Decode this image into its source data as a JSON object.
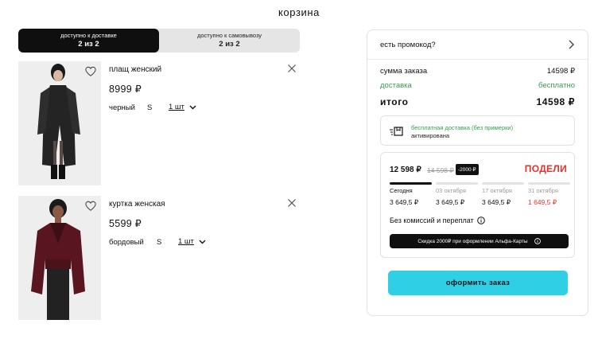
{
  "page": {
    "title": "корзина"
  },
  "delivery_tabs": [
    {
      "label": "доступно к доставке",
      "count": "2 из 2",
      "active": true
    },
    {
      "label": "доступно к самовывозу",
      "count": "2 из 2",
      "active": false
    }
  ],
  "products": [
    {
      "name": "плащ женский",
      "price": "8999 ₽",
      "color": "черный",
      "size": "S",
      "qty": "1 шт",
      "icon_favorite": "heart-icon",
      "icon_remove": "close-icon"
    },
    {
      "name": "куртка женская",
      "price": "5599 ₽",
      "color": "бордовый",
      "size": "S",
      "qty": "1 шт",
      "icon_favorite": "heart-icon",
      "icon_remove": "close-icon"
    }
  ],
  "summary": {
    "promo_label": "есть промокод?",
    "order_sum_label": "сумма заказа",
    "order_sum_value": "14598 ₽",
    "delivery_label": "доставка",
    "delivery_value": "бесплатно",
    "total_label": "итого",
    "total_value": "14598 ₽",
    "free_delivery_line1": "бесплатная доставка (без примерки)",
    "free_delivery_line2": "активирована",
    "checkout_label": "оформить заказ",
    "accent_color": "#2fd0e5",
    "green_color": "#33a04a"
  },
  "split": {
    "brand": "ПОДЕЛИ",
    "price": "12 598 ₽",
    "old_price": "14 598 ₽",
    "discount_badge": "-2000 ₽",
    "payments": [
      {
        "date": "Сегодня",
        "amount": "3 649,5 ₽"
      },
      {
        "date": "03 октября",
        "amount": "3 649,5 ₽"
      },
      {
        "date": "17 октября",
        "amount": "3 649,5 ₽"
      },
      {
        "date": "31 октября",
        "amount": "1 649,5 ₽"
      }
    ],
    "note": "Без комиссий и переплат",
    "alfa_banner": "Скидка 2000₽ при оформлении Альфа-Карты",
    "brand_color": "#e8302b"
  }
}
